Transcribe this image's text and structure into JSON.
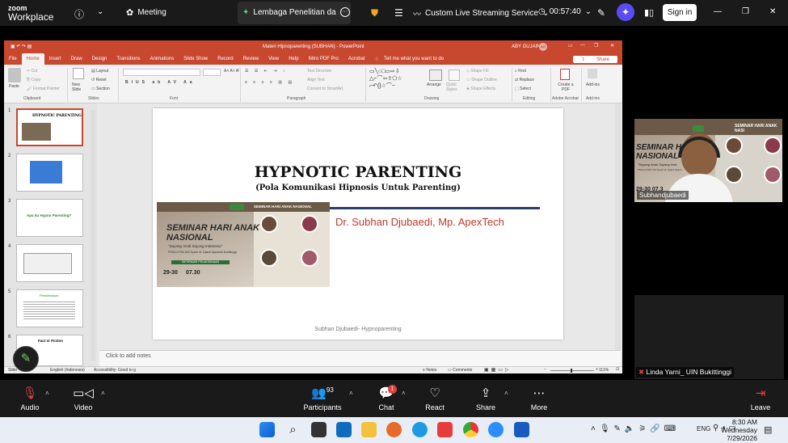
{
  "zoom": {
    "logo_line1": "zoom",
    "logo_line2": "Workplace",
    "meeting_label": "Meeting",
    "active_tab": "Lembaga Penelitian da",
    "streaming_label": "Custom Live Streaming Service",
    "timer": "00:57:40",
    "signin_label": "Sign in",
    "colors": {
      "bar": "#1a1a1a",
      "accent_shield": "#f5a623"
    }
  },
  "ppt": {
    "window_title": "Materi Hipnoparenting (SUBHAN)  -  PowerPoint",
    "user": "ABY GUJAINT",
    "user_initials": "AG",
    "menu": [
      "File",
      "Home",
      "Insert",
      "Draw",
      "Design",
      "Transitions",
      "Animations",
      "Slide Show",
      "Record",
      "Review",
      "View",
      "Help",
      "Nitro PDF Pro",
      "Acrobat"
    ],
    "tell_me": "Tell me what you want to do",
    "share": "Share",
    "ribbon_groups": [
      "Clipboard",
      "Slides",
      "Font",
      "Paragraph",
      "Drawing",
      "Editing",
      "Adobe Acrobat",
      "Add-ins"
    ],
    "ribbon_labels": {
      "paste": "Paste",
      "cut": "Cut",
      "copy": "Copy",
      "format_painter": "Format Painter",
      "new_slide": "New Slide",
      "layout": "Layout",
      "reset": "Reset",
      "section": "Section",
      "text_direction": "Text Direction",
      "align_text": "Align Text",
      "convert_smartart": "Convert to SmartArt",
      "arrange": "Arrange",
      "quick_styles": "Quick Styles",
      "shape_fill": "Shape Fill",
      "shape_outline": "Shape Outline",
      "shape_effects": "Shape Effects",
      "find": "Find",
      "replace": "Replace",
      "select": "Select",
      "create_pdf": "Create a PDF",
      "addins": "Add-ins"
    },
    "thumb_numbers": [
      "1",
      "2",
      "3",
      "4",
      "5",
      "6"
    ],
    "thumb_texts": [
      "HYPNOTIC PARENTING",
      "",
      "Apa itu Hypno Parenting?",
      "",
      "Pendahuluan",
      "Fact or Fiction"
    ],
    "slide": {
      "title": "HYPNOTIC PARENTING",
      "subtitle": "(Pola Komunikasi Hipnosis Untuk Parenting)",
      "author": "Dr. Subhan Djubaedi, Mp. ApexTech",
      "footer": "Subhan Djubaedi- Hypnoparenting",
      "poster": {
        "header": "SEMINAR HARI ANAK NASIONAL",
        "title_line1": "SEMINAR HARI ANAK",
        "title_line2": "NASIONAL",
        "tagline": "\"Sayang Anak Sayang Indonesia\"",
        "org": "PSGA LP2M UIN Syech M. Djamil Djambek Bukittinggi",
        "info": "INFORMASI PELAKSANAAN",
        "date": "29-30",
        "time": "07.30"
      }
    },
    "notes_placeholder": "Click to add notes",
    "status": {
      "slide": "Slide",
      "language": "English (Indonesia)",
      "accessibility": "Accessibility: Good to g",
      "notes": "Notes",
      "comments": "Comments",
      "zoom": "111%"
    }
  },
  "videos": {
    "participant1": "Subhandjubaedi",
    "participant1_poster": "SEMINAR HARI ANAK NASI",
    "participant1_title1": "SEMINAR HAR",
    "participant1_title2": "NASIONAL",
    "participant1_tagline": "\"Sayang Anak Sayang Indo",
    "participant1_org": "PSGA LP2M UIN Syech M. Djamil Djamb",
    "participant1_time": "29-30   07.3",
    "participant2": "Linda Yarni_ UIN Bukittinggi"
  },
  "toolbar": {
    "audio": "Audio",
    "video": "Video",
    "participants": "Participants",
    "participants_count": "93",
    "chat": "Chat",
    "chat_badge": "1",
    "react": "React",
    "share": "Share",
    "more": "More",
    "leave": "Leave"
  },
  "taskbar": {
    "time": "8:30 AM",
    "day": "Wednesday",
    "date": "7/29/2026",
    "lang": "ENG"
  }
}
